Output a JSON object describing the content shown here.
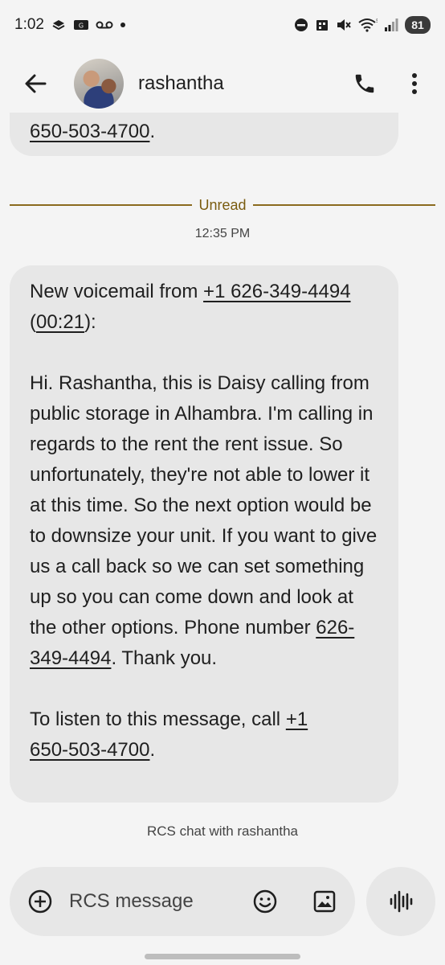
{
  "status_bar": {
    "time": "1:02",
    "battery": "81"
  },
  "header": {
    "contact_name": "rashantha"
  },
  "previous_message": {
    "tail_text": "650-503-4700",
    "tail_suffix": "."
  },
  "divider": {
    "unread_label": "Unread"
  },
  "message": {
    "timestamp": "12:35 PM",
    "intro_prefix": "New voicemail from ",
    "caller_number": "+1 626-349-4494",
    "duration_open": "(",
    "duration": "00:21",
    "duration_close": "):",
    "body": "Hi. Rashantha, this is Daisy calling from public storage in Alhambra. I'm calling in regards to the rent the rent issue. So unfortunately, they're not able to lower it at this time. So the next option would be to downsize your unit. If you want to give us a call back so we can set something up so you can come down and look at the other options. Phone number ",
    "body_number": "626-349-4494",
    "body_suffix": ". Thank you.",
    "listen_prefix": "To listen to this message, call ",
    "listen_number_part1": "+1",
    "listen_number_part2": "650-503-4700",
    "listen_suffix": "."
  },
  "chat_info": {
    "label": "RCS chat with rashantha"
  },
  "composer": {
    "placeholder": "RCS message"
  },
  "colors": {
    "background": "#f4f4f4",
    "bubble": "#e7e7e7",
    "unread_accent": "#8a6b1e"
  }
}
